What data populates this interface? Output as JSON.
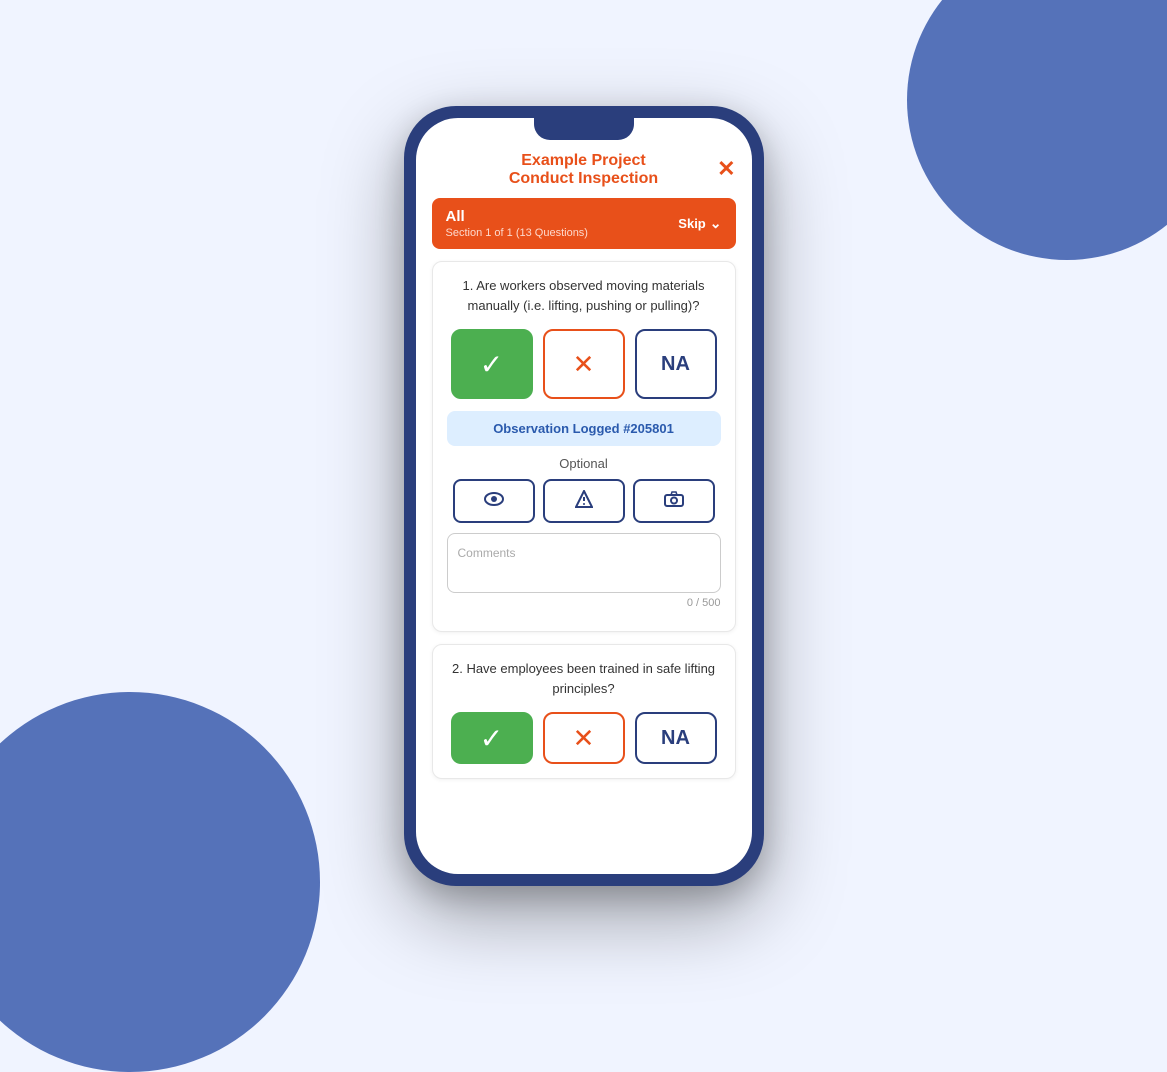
{
  "background": {
    "color": "#e8f0ff"
  },
  "header": {
    "project_title": "Example Project",
    "inspection_title": "Conduct Inspection",
    "close_label": "✕"
  },
  "section": {
    "name": "All",
    "subtitle": "Section 1 of 1 (13 Questions)",
    "skip_label": "Skip",
    "chevron": "⌄"
  },
  "question1": {
    "number": "1.",
    "text": "Are workers observed moving materials manually (i.e. lifting, pushing or pulling)?",
    "yes_label": "✓",
    "no_label": "✕",
    "na_label": "NA",
    "observation_logged": "Observation Logged #205801",
    "optional_label": "Optional",
    "comments_placeholder": "Comments",
    "char_count": "0 / 500"
  },
  "question2": {
    "number": "2.",
    "text": "Have employees been trained in safe lifting principles?",
    "yes_label": "✓",
    "no_label": "✕",
    "na_label": "NA"
  },
  "icons": {
    "eye": "👁",
    "alert": "⚠",
    "camera": "📷"
  }
}
